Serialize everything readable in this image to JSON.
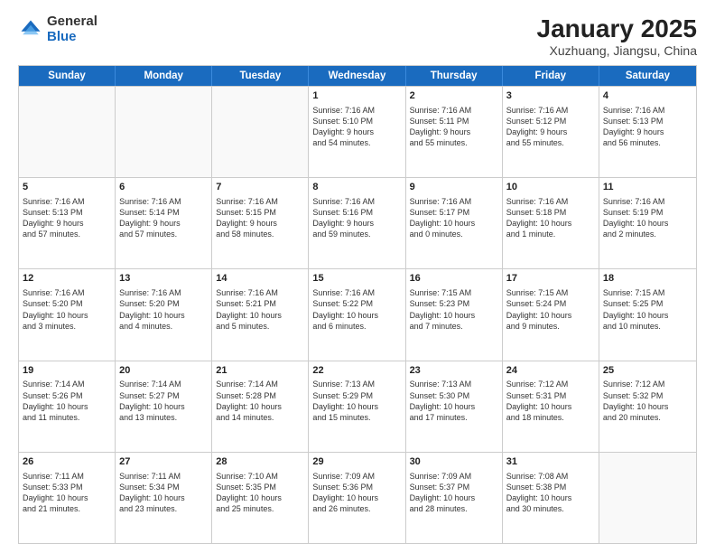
{
  "header": {
    "logo": {
      "line1": "General",
      "line2": "Blue"
    },
    "title": "January 2025",
    "subtitle": "Xuzhuang, Jiangsu, China"
  },
  "weekdays": [
    "Sunday",
    "Monday",
    "Tuesday",
    "Wednesday",
    "Thursday",
    "Friday",
    "Saturday"
  ],
  "weeks": [
    {
      "cells": [
        {
          "day": "",
          "empty": true
        },
        {
          "day": "",
          "empty": true
        },
        {
          "day": "",
          "empty": true
        },
        {
          "day": "1",
          "lines": [
            "Sunrise: 7:16 AM",
            "Sunset: 5:10 PM",
            "Daylight: 9 hours",
            "and 54 minutes."
          ]
        },
        {
          "day": "2",
          "lines": [
            "Sunrise: 7:16 AM",
            "Sunset: 5:11 PM",
            "Daylight: 9 hours",
            "and 55 minutes."
          ]
        },
        {
          "day": "3",
          "lines": [
            "Sunrise: 7:16 AM",
            "Sunset: 5:12 PM",
            "Daylight: 9 hours",
            "and 55 minutes."
          ]
        },
        {
          "day": "4",
          "lines": [
            "Sunrise: 7:16 AM",
            "Sunset: 5:13 PM",
            "Daylight: 9 hours",
            "and 56 minutes."
          ]
        }
      ]
    },
    {
      "cells": [
        {
          "day": "5",
          "lines": [
            "Sunrise: 7:16 AM",
            "Sunset: 5:13 PM",
            "Daylight: 9 hours",
            "and 57 minutes."
          ]
        },
        {
          "day": "6",
          "lines": [
            "Sunrise: 7:16 AM",
            "Sunset: 5:14 PM",
            "Daylight: 9 hours",
            "and 57 minutes."
          ]
        },
        {
          "day": "7",
          "lines": [
            "Sunrise: 7:16 AM",
            "Sunset: 5:15 PM",
            "Daylight: 9 hours",
            "and 58 minutes."
          ]
        },
        {
          "day": "8",
          "lines": [
            "Sunrise: 7:16 AM",
            "Sunset: 5:16 PM",
            "Daylight: 9 hours",
            "and 59 minutes."
          ]
        },
        {
          "day": "9",
          "lines": [
            "Sunrise: 7:16 AM",
            "Sunset: 5:17 PM",
            "Daylight: 10 hours",
            "and 0 minutes."
          ]
        },
        {
          "day": "10",
          "lines": [
            "Sunrise: 7:16 AM",
            "Sunset: 5:18 PM",
            "Daylight: 10 hours",
            "and 1 minute."
          ]
        },
        {
          "day": "11",
          "lines": [
            "Sunrise: 7:16 AM",
            "Sunset: 5:19 PM",
            "Daylight: 10 hours",
            "and 2 minutes."
          ]
        }
      ]
    },
    {
      "cells": [
        {
          "day": "12",
          "lines": [
            "Sunrise: 7:16 AM",
            "Sunset: 5:20 PM",
            "Daylight: 10 hours",
            "and 3 minutes."
          ]
        },
        {
          "day": "13",
          "lines": [
            "Sunrise: 7:16 AM",
            "Sunset: 5:20 PM",
            "Daylight: 10 hours",
            "and 4 minutes."
          ]
        },
        {
          "day": "14",
          "lines": [
            "Sunrise: 7:16 AM",
            "Sunset: 5:21 PM",
            "Daylight: 10 hours",
            "and 5 minutes."
          ]
        },
        {
          "day": "15",
          "lines": [
            "Sunrise: 7:16 AM",
            "Sunset: 5:22 PM",
            "Daylight: 10 hours",
            "and 6 minutes."
          ]
        },
        {
          "day": "16",
          "lines": [
            "Sunrise: 7:15 AM",
            "Sunset: 5:23 PM",
            "Daylight: 10 hours",
            "and 7 minutes."
          ]
        },
        {
          "day": "17",
          "lines": [
            "Sunrise: 7:15 AM",
            "Sunset: 5:24 PM",
            "Daylight: 10 hours",
            "and 9 minutes."
          ]
        },
        {
          "day": "18",
          "lines": [
            "Sunrise: 7:15 AM",
            "Sunset: 5:25 PM",
            "Daylight: 10 hours",
            "and 10 minutes."
          ]
        }
      ]
    },
    {
      "cells": [
        {
          "day": "19",
          "lines": [
            "Sunrise: 7:14 AM",
            "Sunset: 5:26 PM",
            "Daylight: 10 hours",
            "and 11 minutes."
          ]
        },
        {
          "day": "20",
          "lines": [
            "Sunrise: 7:14 AM",
            "Sunset: 5:27 PM",
            "Daylight: 10 hours",
            "and 13 minutes."
          ]
        },
        {
          "day": "21",
          "lines": [
            "Sunrise: 7:14 AM",
            "Sunset: 5:28 PM",
            "Daylight: 10 hours",
            "and 14 minutes."
          ]
        },
        {
          "day": "22",
          "lines": [
            "Sunrise: 7:13 AM",
            "Sunset: 5:29 PM",
            "Daylight: 10 hours",
            "and 15 minutes."
          ]
        },
        {
          "day": "23",
          "lines": [
            "Sunrise: 7:13 AM",
            "Sunset: 5:30 PM",
            "Daylight: 10 hours",
            "and 17 minutes."
          ]
        },
        {
          "day": "24",
          "lines": [
            "Sunrise: 7:12 AM",
            "Sunset: 5:31 PM",
            "Daylight: 10 hours",
            "and 18 minutes."
          ]
        },
        {
          "day": "25",
          "lines": [
            "Sunrise: 7:12 AM",
            "Sunset: 5:32 PM",
            "Daylight: 10 hours",
            "and 20 minutes."
          ]
        }
      ]
    },
    {
      "cells": [
        {
          "day": "26",
          "lines": [
            "Sunrise: 7:11 AM",
            "Sunset: 5:33 PM",
            "Daylight: 10 hours",
            "and 21 minutes."
          ]
        },
        {
          "day": "27",
          "lines": [
            "Sunrise: 7:11 AM",
            "Sunset: 5:34 PM",
            "Daylight: 10 hours",
            "and 23 minutes."
          ]
        },
        {
          "day": "28",
          "lines": [
            "Sunrise: 7:10 AM",
            "Sunset: 5:35 PM",
            "Daylight: 10 hours",
            "and 25 minutes."
          ]
        },
        {
          "day": "29",
          "lines": [
            "Sunrise: 7:09 AM",
            "Sunset: 5:36 PM",
            "Daylight: 10 hours",
            "and 26 minutes."
          ]
        },
        {
          "day": "30",
          "lines": [
            "Sunrise: 7:09 AM",
            "Sunset: 5:37 PM",
            "Daylight: 10 hours",
            "and 28 minutes."
          ]
        },
        {
          "day": "31",
          "lines": [
            "Sunrise: 7:08 AM",
            "Sunset: 5:38 PM",
            "Daylight: 10 hours",
            "and 30 minutes."
          ]
        },
        {
          "day": "",
          "empty": true
        }
      ]
    }
  ]
}
